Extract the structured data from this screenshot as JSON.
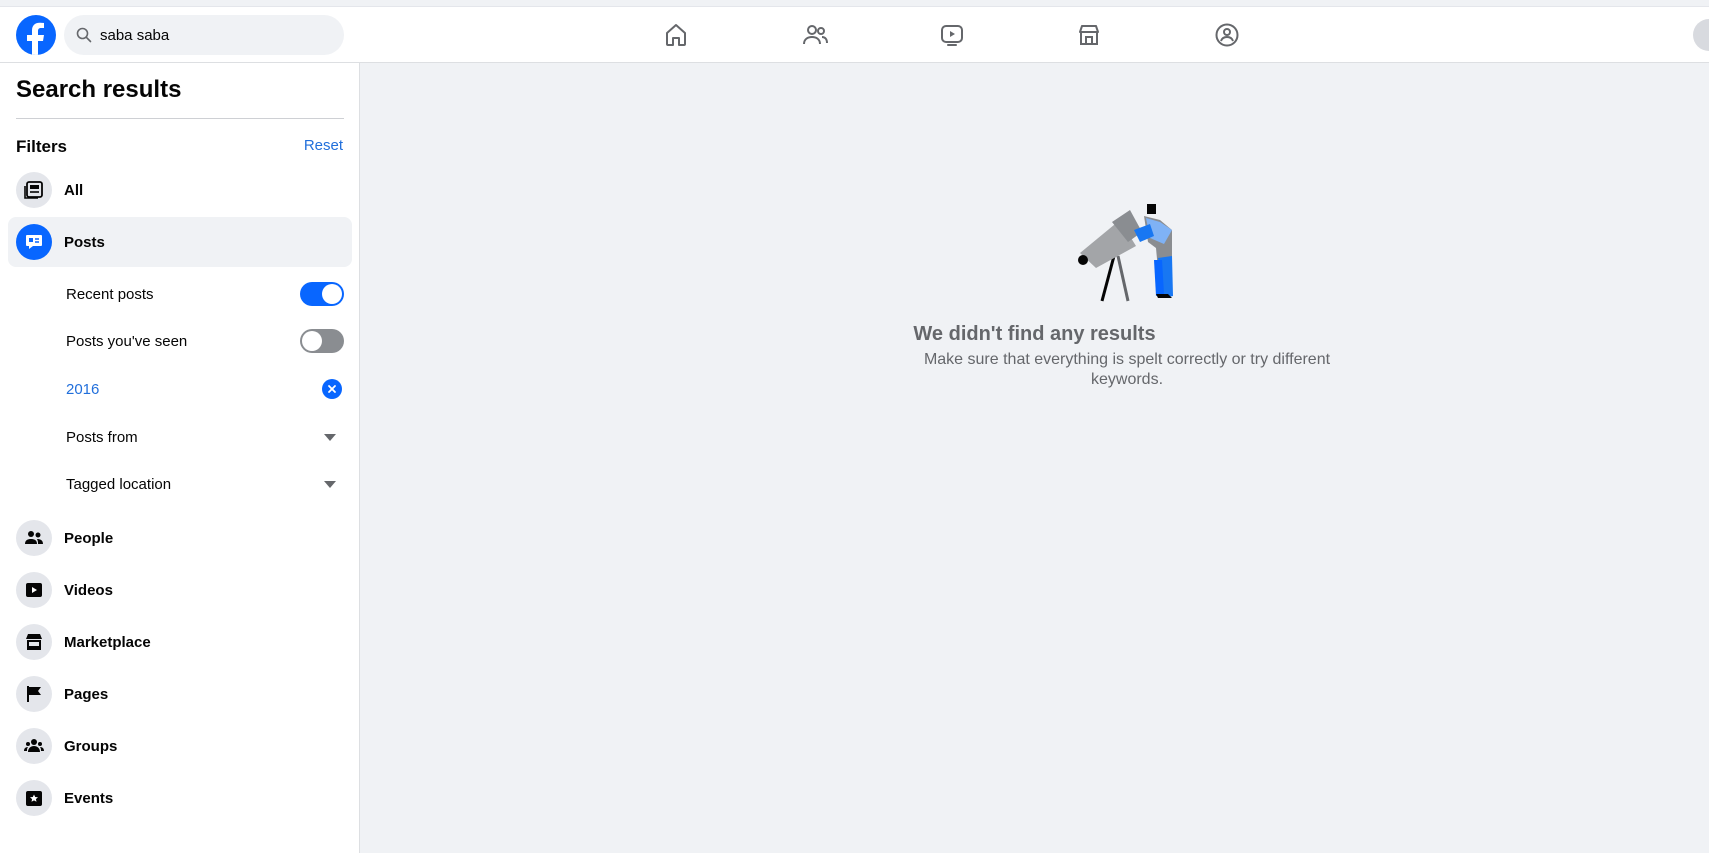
{
  "search": {
    "value": "saba saba"
  },
  "sidebar": {
    "title": "Search results",
    "filters_label": "Filters",
    "reset_label": "Reset",
    "categories": [
      {
        "label": "All",
        "icon": "all-icon"
      },
      {
        "label": "Posts",
        "icon": "posts-icon",
        "active": true
      },
      {
        "label": "People",
        "icon": "people-icon"
      },
      {
        "label": "Videos",
        "icon": "videos-icon"
      },
      {
        "label": "Marketplace",
        "icon": "marketplace-icon"
      },
      {
        "label": "Pages",
        "icon": "pages-icon"
      },
      {
        "label": "Groups",
        "icon": "groups-icon"
      },
      {
        "label": "Events",
        "icon": "events-icon"
      }
    ],
    "posts_filters": {
      "recent_posts": {
        "label": "Recent posts",
        "enabled": true
      },
      "posts_seen": {
        "label": "Posts you've seen",
        "enabled": false
      },
      "date": {
        "label": "2016"
      },
      "posts_from": {
        "label": "Posts from"
      },
      "tagged_location": {
        "label": "Tagged location"
      }
    }
  },
  "main": {
    "empty_title": "We didn't find any results",
    "empty_subtitle": "Make sure that everything is spelt correctly or try different keywords."
  },
  "colors": {
    "accent": "#0866ff",
    "link": "#216fdb",
    "background": "#f0f2f5"
  }
}
